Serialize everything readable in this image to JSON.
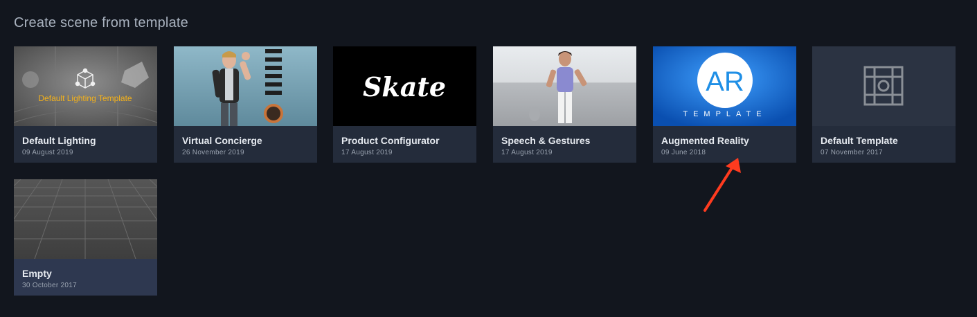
{
  "page": {
    "title": "Create scene from template"
  },
  "templates": [
    {
      "name": "Default Lighting",
      "date": "09 August 2019",
      "thumb_label": "Default Lighting Template",
      "thumb_icon": "cube-network-icon"
    },
    {
      "name": "Virtual Concierge",
      "date": "26 November 2019",
      "thumb_icon": "host-character-icon"
    },
    {
      "name": "Product Configurator",
      "date": "17 August 2019",
      "thumb_label": "Skate"
    },
    {
      "name": "Speech & Gestures",
      "date": "17 August 2019",
      "thumb_icon": "host-character-icon"
    },
    {
      "name": "Augmented Reality",
      "date": "09 June 2018",
      "thumb_label": "AR",
      "thumb_sublabel": "TEMPLATE"
    },
    {
      "name": "Default Template",
      "date": "07 November 2017",
      "thumb_icon": "template-grid-icon"
    },
    {
      "name": "Empty",
      "date": "30 October 2017",
      "thumb_icon": "grid-floor-icon"
    }
  ],
  "colors": {
    "background": "#12161e",
    "card_info": "#242c3b",
    "accent_arrow": "#ff3b1f",
    "ar_blue": "#1166cc"
  }
}
